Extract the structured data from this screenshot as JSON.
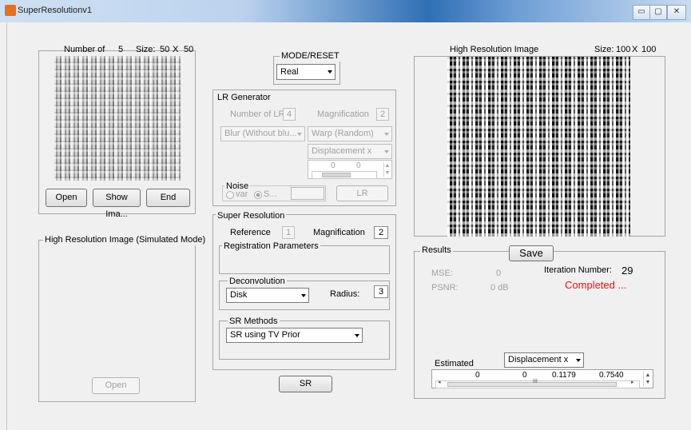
{
  "window": {
    "title": "SuperResolutionv1",
    "minimize": "▭",
    "maximize": "▢",
    "close": "✕"
  },
  "left_panel": {
    "number_label": "Number of",
    "number_value": "5",
    "size_label": "Size:",
    "size_w": "50",
    "size_x": "X",
    "size_h": "50",
    "open_button": "Open",
    "show_button": "Show Ima...",
    "end_button": "End"
  },
  "hr_sim": {
    "title": "High Resolution Image (Simulated Mode)",
    "open_button": "Open"
  },
  "mode": {
    "title": "MODE/RESET",
    "value": "Real"
  },
  "lr_gen": {
    "title": "LR Generator",
    "num_lr_label": "Number of LR",
    "num_lr_value": "4",
    "mag_label": "Magnification",
    "mag_value": "2",
    "blur_value": "Blur (Without blu...",
    "warp_value": "Warp (Random)",
    "disp_value": "Displacement x",
    "disp_val1": "0",
    "disp_val2": "0",
    "noise_title": "Noise",
    "noise_var": "var",
    "noise_s": "S...",
    "lr_button": "LR"
  },
  "sr": {
    "title": "Super Resolution",
    "ref_label": "Reference",
    "ref_value": "1",
    "mag_label": "Magnification",
    "mag_value": "2",
    "reg_title": "Registration Parameters",
    "deconv_title": "Deconvolution",
    "deconv_value": "Disk",
    "radius_label": "Radius:",
    "radius_value": "3",
    "methods_title": "SR Methods",
    "method_value": "SR using TV Prior",
    "sr_button": "SR"
  },
  "hr_image": {
    "title": "High Resolution Image",
    "size_label": "Size:",
    "size_w": "100",
    "size_x": "X",
    "size_h": "100"
  },
  "results": {
    "title": "Results",
    "save_button": "Save",
    "mse_label": "MSE:",
    "mse_value": "0",
    "psnr_label": "PSNR:",
    "psnr_value": "0 dB",
    "iter_label": "Iteration Number:",
    "iter_value": "29",
    "status": "Completed ...",
    "estimated_label": "Estimated",
    "estimated_value": "Displacement x",
    "est_vals": [
      "0",
      "0",
      "0.1179",
      "0.7540"
    ],
    "scroll_mark": "III"
  }
}
